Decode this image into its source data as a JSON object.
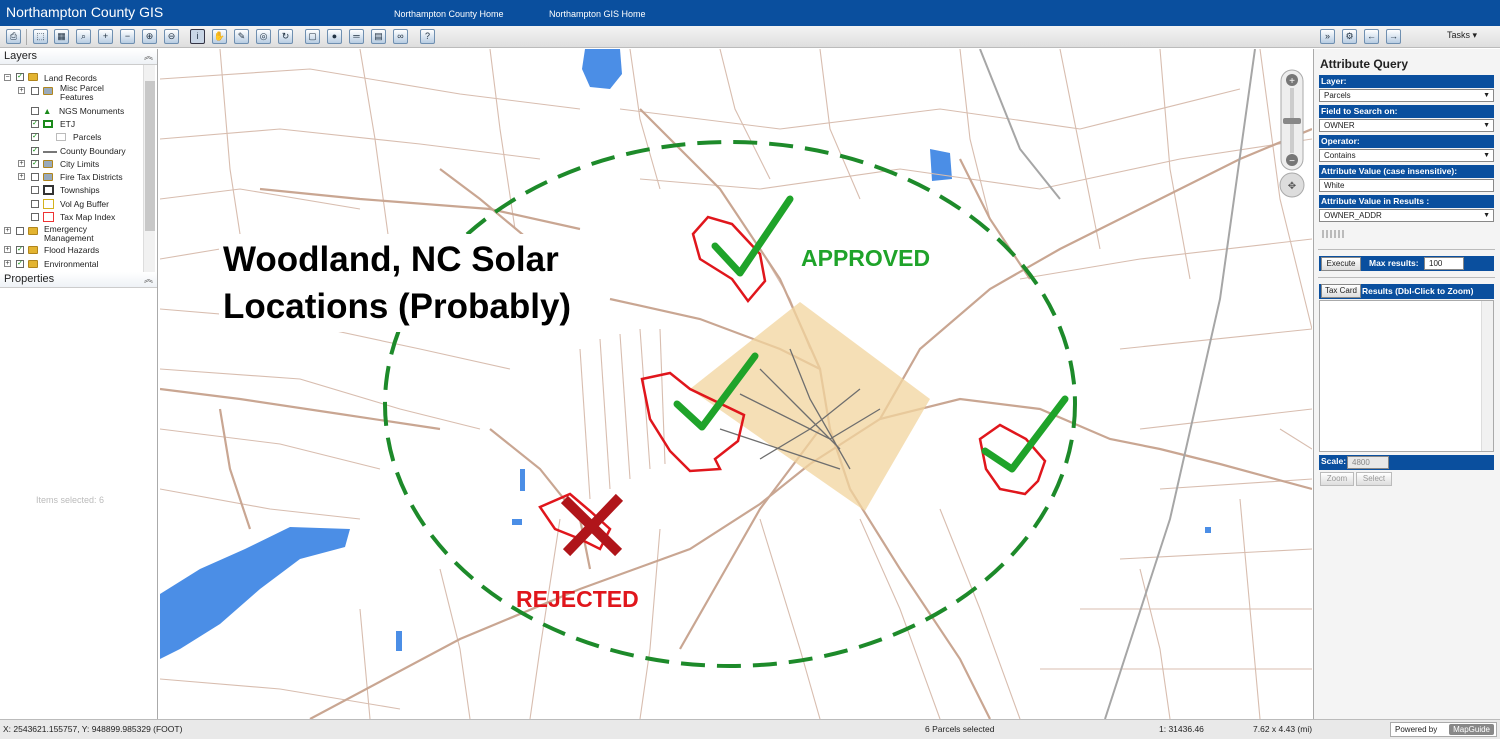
{
  "header": {
    "title": "Northampton County GIS",
    "link1": "Northampton County Home",
    "link2": "Northampton GIS Home"
  },
  "toolbar": {
    "tasks_label": "Tasks"
  },
  "left": {
    "layers_title": "Layers",
    "properties_title": "Properties",
    "items_selected": "Items selected: 6",
    "layers": [
      {
        "label": "Land Records"
      },
      {
        "label": "Misc Parcel Features"
      },
      {
        "label": "NGS Monuments"
      },
      {
        "label": "ETJ"
      },
      {
        "label": "Parcels"
      },
      {
        "label": "County Boundary"
      },
      {
        "label": "City Limits"
      },
      {
        "label": "Fire Tax Districts"
      },
      {
        "label": "Townships"
      },
      {
        "label": "Vol Ag Buffer"
      },
      {
        "label": "Tax Map Index"
      },
      {
        "label": "Emergency Management"
      },
      {
        "label": "Flood Hazards"
      },
      {
        "label": "Environmental"
      }
    ]
  },
  "map": {
    "title_line1": "Woodland, NC Solar",
    "title_line2": "Locations (Probably)",
    "approved": "APPROVED",
    "rejected": "REJECTED",
    "colors": {
      "approved": "#1fa32a",
      "rejected": "#e0161c",
      "ring": "#1d8a2a",
      "roads": "#c9a692",
      "water": "#4b8ee6"
    }
  },
  "panel": {
    "title": "Attribute Query",
    "layer_label": "Layer:",
    "layer_value": "Parcels",
    "field_label": "Field to Search on:",
    "field_value": "OWNER",
    "operator_label": "Operator:",
    "operator_value": "Contains",
    "attr_label": "Attribute Value (case insensitive):",
    "attr_value": "White",
    "results_label": "Attribute Value in Results :",
    "results_value": "OWNER_ADDR",
    "execute": "Execute",
    "max_label": "Max results:",
    "max_value": "100",
    "taxcard": "Tax Card",
    "results_header": "Results (Dbl-Click to Zoom)",
    "scale_label": "Scale:",
    "scale_value": "4800",
    "zoom": "Zoom",
    "select": "Select"
  },
  "status": {
    "coords": "X: 2543621.155757, Y: 948899.985329 (FOOT)",
    "selected": "6 Parcels selected",
    "scale": "1: 31436.46",
    "extent": "7.62 x 4.43 (mi)",
    "powered": "Powered by",
    "brand": "MapGuide"
  }
}
